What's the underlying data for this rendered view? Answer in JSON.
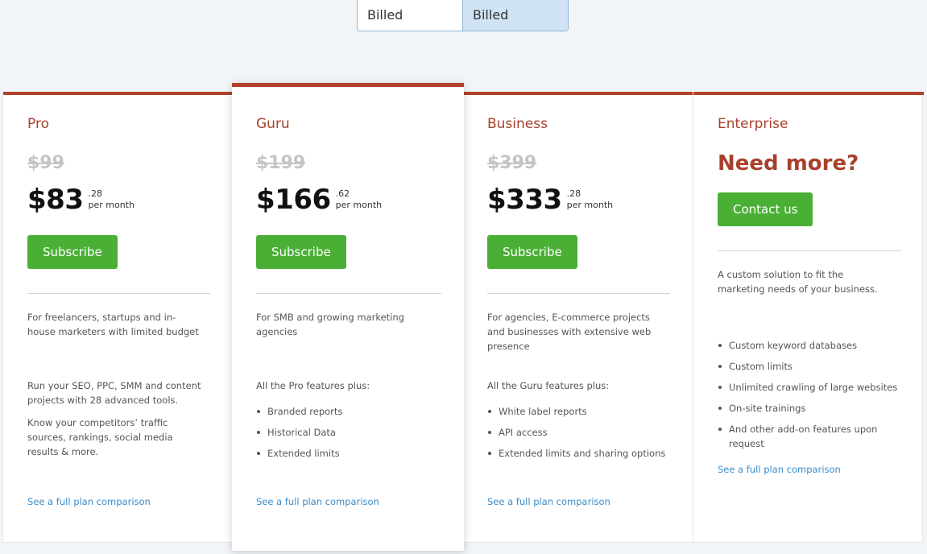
{
  "billing_toggle": {
    "monthly": "Billed monthly",
    "annually": "Billed annually",
    "selected": "annually"
  },
  "colors": {
    "accent": "#b0412a",
    "button": "#4ab035",
    "link": "#3a8cc9",
    "toggle_selected": "#cfe3f4"
  },
  "plans": [
    {
      "name": "Pro",
      "old_price": "$99",
      "price": "$83",
      "cents": ".28",
      "period": "per month",
      "button": "Subscribe",
      "description": "For freelancers, startups and in-house marketers with limited budget",
      "paragraphs": [
        "Run your SEO, PPC, SMM and content projects with 28 advanced tools.",
        "Know your competitors’ traffic sources, rankings, social media results & more."
      ],
      "link": "See a full plan comparison"
    },
    {
      "name": "Guru",
      "old_price": "$199",
      "price": "$166",
      "cents": ".62",
      "period": "per month",
      "button": "Subscribe",
      "description": "For SMB and growing marketing agencies",
      "features_intro": "All the Pro features plus:",
      "features": [
        "Branded reports",
        "Historical Data",
        "Extended limits"
      ],
      "link": "See a full plan comparison"
    },
    {
      "name": "Business",
      "old_price": "$399",
      "price": "$333",
      "cents": ".28",
      "period": "per month",
      "button": "Subscribe",
      "description": "For agencies, E-commerce projects and businesses with extensive web presence",
      "features_intro": "All the Guru features plus:",
      "features": [
        "White label reports",
        "API access",
        "Extended limits and sharing options"
      ],
      "link": "See a full plan comparison"
    },
    {
      "name": "Enterprise",
      "headline": "Need more?",
      "button": "Contact us",
      "description": "A custom solution to fit the marketing needs of your business.",
      "features": [
        "Custom keyword databases",
        "Custom limits",
        "Unlimited crawling of large websites",
        "On-site trainings",
        "And other add-on features upon request"
      ],
      "link": "See a full plan comparison"
    }
  ]
}
